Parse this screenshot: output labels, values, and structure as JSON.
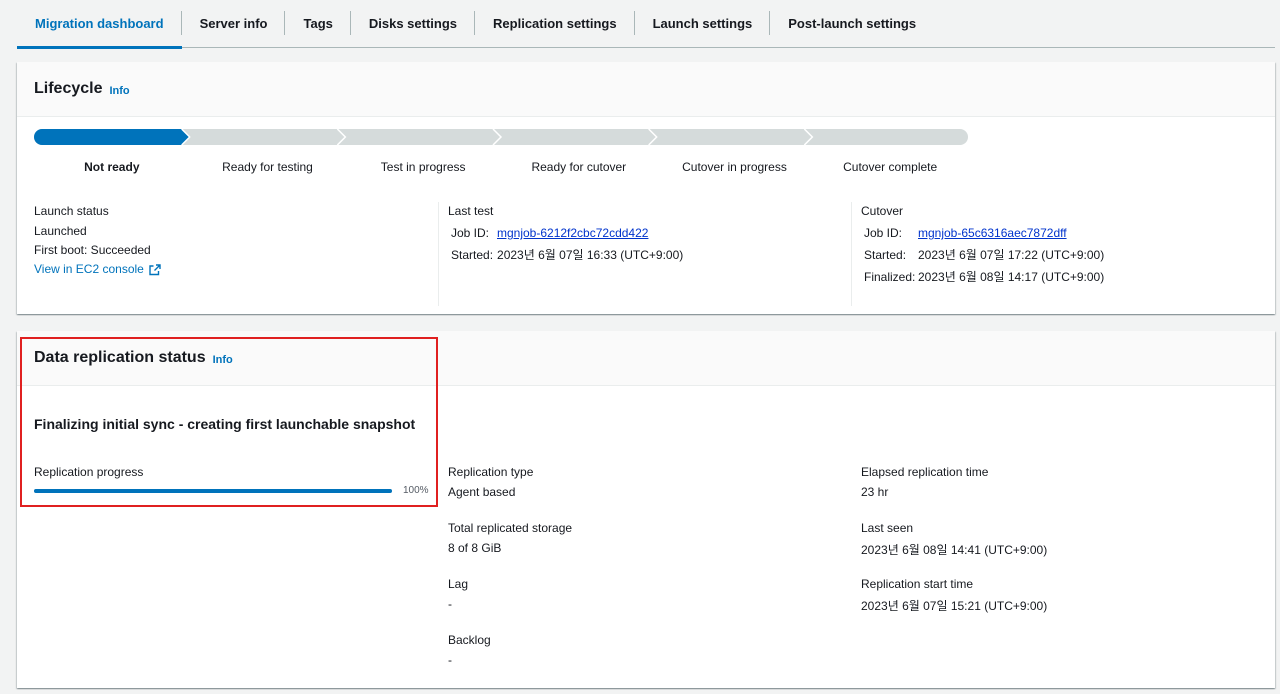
{
  "tabs": [
    {
      "label": "Migration dashboard",
      "active": true
    },
    {
      "label": "Server info"
    },
    {
      "label": "Tags"
    },
    {
      "label": "Disks settings"
    },
    {
      "label": "Replication settings"
    },
    {
      "label": "Launch settings"
    },
    {
      "label": "Post-launch settings"
    }
  ],
  "lifecycle": {
    "title": "Lifecycle",
    "info": "Info",
    "steps": [
      "Not ready",
      "Ready for testing",
      "Test in progress",
      "Ready for cutover",
      "Cutover in progress",
      "Cutover complete"
    ],
    "current_step": 0,
    "launch_status": {
      "heading": "Launch status",
      "status": "Launched",
      "first_boot": "First boot: Succeeded",
      "console_link": "View in EC2 console"
    },
    "last_test": {
      "heading": "Last test",
      "job_label": "Job ID:",
      "job_id": "mgnjob-6212f2cbc72cdd422",
      "started_label": "Started:",
      "started": "2023년 6월 07일 16:33 (UTC+9:00)"
    },
    "cutover": {
      "heading": "Cutover",
      "job_label": "Job ID:",
      "job_id": "mgnjob-65c6316aec7872dff",
      "started_label": "Started:",
      "started": "2023년 6월 07일 17:22 (UTC+9:00)",
      "finalized_label": "Finalized:",
      "finalized": "2023년 6월 08일 14:17 (UTC+9:00)"
    }
  },
  "replication": {
    "title": "Data replication status",
    "info": "Info",
    "status_text": "Finalizing initial sync - creating first launchable snapshot",
    "progress_label": "Replication progress",
    "progress_percent": 100,
    "progress_text": "100%",
    "replication_type_label": "Replication type",
    "replication_type": "Agent based",
    "total_storage_label": "Total replicated storage",
    "total_storage": "8 of 8 GiB",
    "lag_label": "Lag",
    "lag": "-",
    "backlog_label": "Backlog",
    "backlog": "-",
    "elapsed_label": "Elapsed replication time",
    "elapsed": "23 hr",
    "last_seen_label": "Last seen",
    "last_seen": "2023년 6월 08일 14:41 (UTC+9:00)",
    "start_time_label": "Replication start time",
    "start_time": "2023년 6월 07일 15:21 (UTC+9:00)"
  },
  "colors": {
    "accent": "#0073bb",
    "stepper_inactive": "#d5dbdb",
    "link": "#0033cc",
    "highlight": "#e02020"
  }
}
